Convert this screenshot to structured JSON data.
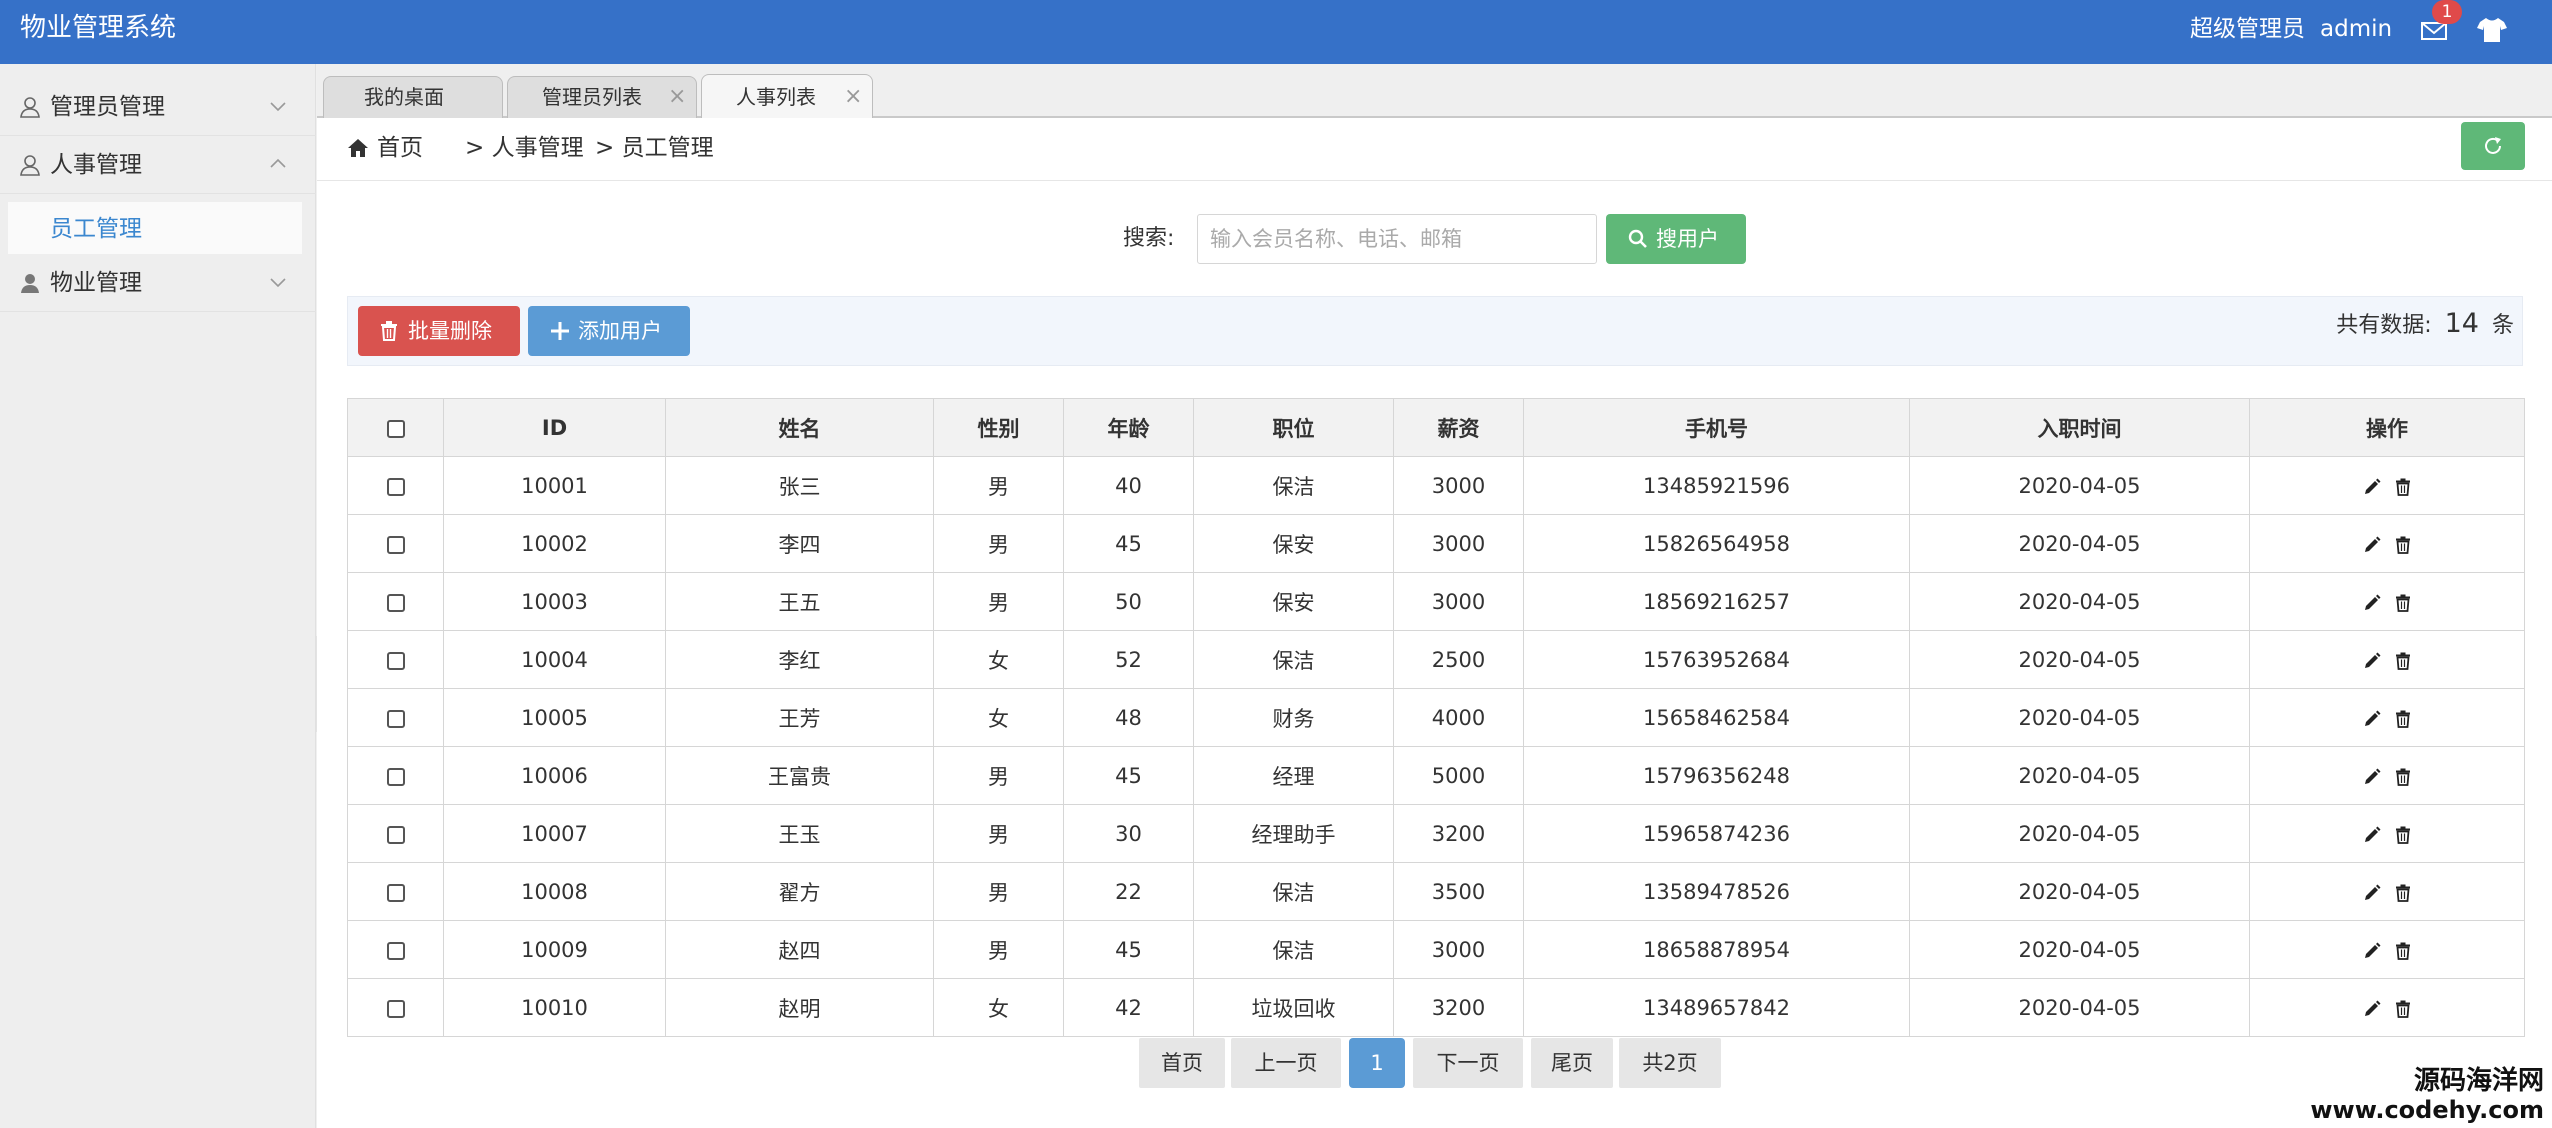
{
  "header": {
    "title": "物业管理系统",
    "user_role": "超级管理员",
    "user_name": "admin",
    "mail_badge": "1",
    "color_bg": "#3671c8"
  },
  "sidebar": {
    "items": [
      {
        "label": "管理员管理",
        "icon": "user-outline-icon",
        "expanded": false
      },
      {
        "label": "人事管理",
        "icon": "user-outline-icon",
        "expanded": true,
        "children": [
          {
            "label": "员工管理",
            "active": true
          }
        ]
      },
      {
        "label": "物业管理",
        "icon": "user-solid-icon",
        "expanded": false
      }
    ]
  },
  "tabs": [
    {
      "label": "我的桌面",
      "closable": false
    },
    {
      "label": "管理员列表",
      "closable": true
    },
    {
      "label": "人事列表",
      "closable": true,
      "active": true
    }
  ],
  "breadcrumb": {
    "home": "首页",
    "level1": "> 人事管理",
    "level2": "> 员工管理"
  },
  "search": {
    "label": "搜索:",
    "placeholder": "输入会员名称、电话、邮箱",
    "button": "搜用户"
  },
  "toolbar": {
    "batch_delete": "批量删除",
    "add_user": "添加用户",
    "total_prefix": "共有数据:",
    "total_count": "14",
    "total_suffix": "条"
  },
  "table": {
    "columns": [
      "ID",
      "姓名",
      "性别",
      "年龄",
      "职位",
      "薪资",
      "手机号",
      "入职时间",
      "操作"
    ],
    "rows": [
      [
        "10001",
        "张三",
        "男",
        "40",
        "保洁",
        "3000",
        "13485921596",
        "2020-04-05"
      ],
      [
        "10002",
        "李四",
        "男",
        "45",
        "保安",
        "3000",
        "15826564958",
        "2020-04-05"
      ],
      [
        "10003",
        "王五",
        "男",
        "50",
        "保安",
        "3000",
        "18569216257",
        "2020-04-05"
      ],
      [
        "10004",
        "李红",
        "女",
        "52",
        "保洁",
        "2500",
        "15763952684",
        "2020-04-05"
      ],
      [
        "10005",
        "王芳",
        "女",
        "48",
        "财务",
        "4000",
        "15658462584",
        "2020-04-05"
      ],
      [
        "10006",
        "王富贵",
        "男",
        "45",
        "经理",
        "5000",
        "15796356248",
        "2020-04-05"
      ],
      [
        "10007",
        "王玉",
        "男",
        "30",
        "经理助手",
        "3200",
        "15965874236",
        "2020-04-05"
      ],
      [
        "10008",
        "翟方",
        "男",
        "22",
        "保洁",
        "3500",
        "13589478526",
        "2020-04-05"
      ],
      [
        "10009",
        "赵四",
        "男",
        "45",
        "保洁",
        "3000",
        "18658878954",
        "2020-04-05"
      ],
      [
        "10010",
        "赵明",
        "女",
        "42",
        "垃圾回收",
        "3200",
        "13489657842",
        "2020-04-05"
      ]
    ]
  },
  "pagination": {
    "first": "首页",
    "prev": "上一页",
    "current": "1",
    "next": "下一页",
    "last": "尾页",
    "total": "共2页"
  },
  "watermark": {
    "line1": "源码海洋网",
    "line2": "www.codehy.com"
  },
  "colors": {
    "primary": "#3671c8",
    "success": "#5fb878",
    "danger": "#d9534f",
    "info": "#5b9bd5",
    "link": "#3b87cf"
  }
}
